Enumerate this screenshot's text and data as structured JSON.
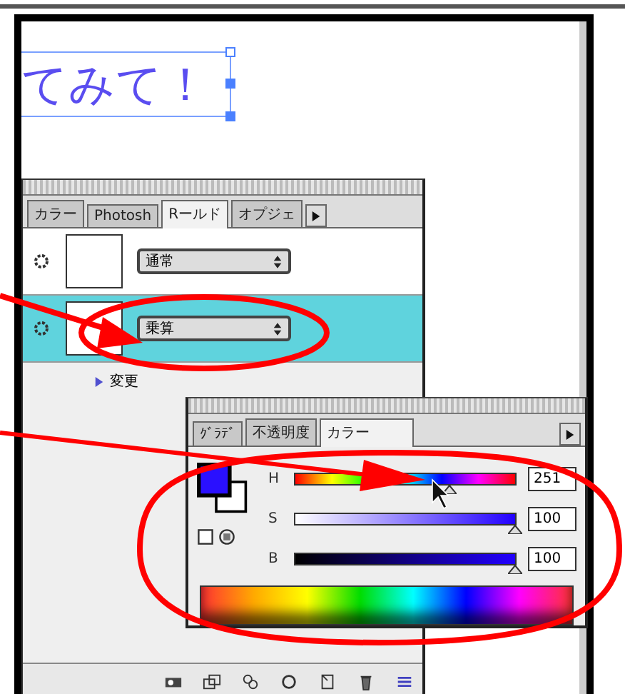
{
  "canvas_text": "てみて！",
  "appearance_panel": {
    "tabs": [
      {
        "label": "カラー",
        "selected": false
      },
      {
        "label": "Photosh",
        "selected": false
      },
      {
        "label": "Rールド",
        "selected": true
      },
      {
        "label": "オプジェ",
        "selected": false
      }
    ],
    "rows": [
      {
        "mode": "通常",
        "selected": false
      },
      {
        "mode": "乗算",
        "selected": true
      }
    ],
    "link": "変更"
  },
  "color_panel": {
    "tabs": [
      {
        "label": "ｸﾞﾗﾃﾞ",
        "selected": false
      },
      {
        "label": "不透明度",
        "selected": false
      },
      {
        "label": "カラー",
        "selected": true
      }
    ],
    "channels": [
      {
        "name": "H",
        "kind": "hue",
        "level": 0.7,
        "value": "251"
      },
      {
        "name": "S",
        "kind": "saturation",
        "level": 1,
        "value": "100"
      },
      {
        "name": "B",
        "kind": "brightness",
        "level": 1,
        "value": "100"
      }
    ]
  }
}
